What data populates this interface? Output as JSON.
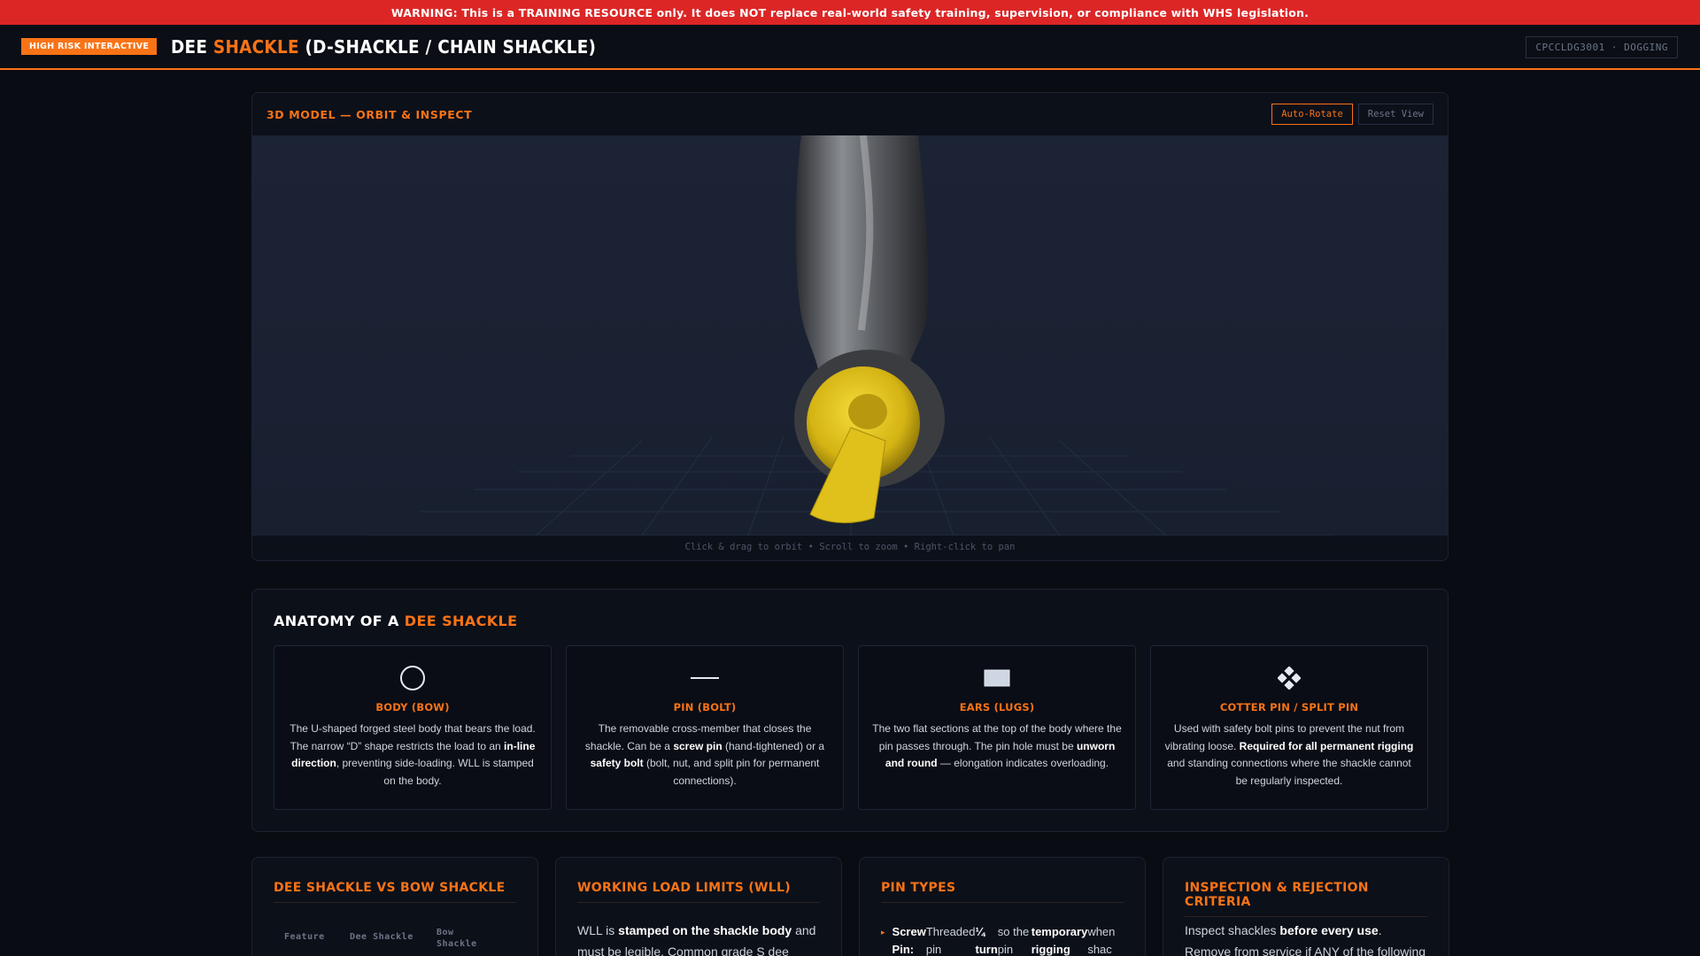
{
  "warning": "WARNING: This is a TRAINING RESOURCE only. It does NOT replace real-world safety training, supervision, or compliance with WHS legislation.",
  "header": {
    "badge": "High Risk Interactive",
    "title_pre": "DEE ",
    "title_accent": "SHACKLE",
    "title_post": " (D-SHACKLE / CHAIN SHACKLE)",
    "course": "CPCCLDG3001 · DOGGING"
  },
  "viewer": {
    "title": "3D Model — Orbit & Inspect",
    "auto_rotate": "Auto-Rotate",
    "reset_view": "Reset View",
    "hint": "Click & drag to orbit • Scroll to zoom • Right-click to pan",
    "colors": {
      "steel": "#5a5d62",
      "pin": "#e3c21a",
      "grid": "#2a3348"
    }
  },
  "anatomy": {
    "title_pre": "Anatomy of a ",
    "title_accent": "Dee Shackle",
    "cards": [
      {
        "icon": "circle-icon",
        "name": "Body (Bow)",
        "desc_parts": [
          "The U-shaped forged steel body that bears the load. The narrow “D” shape restricts the load to an ",
          "in-line direction",
          ", preventing side-loading. WLL is stamped on the body."
        ]
      },
      {
        "icon": "line-icon",
        "name": "Pin (Bolt)",
        "desc_parts": [
          "The removable cross-member that closes the shackle. Can be a ",
          "screw pin",
          " (hand-tightened) or a ",
          "safety bolt",
          " (bolt, nut, and split pin for permanent connections)."
        ]
      },
      {
        "icon": "square-icon",
        "name": "Ears (Lugs)",
        "desc_parts": [
          "The two flat sections at the top of the body where the pin passes through. The pin hole must be ",
          "unworn and round",
          " — elongation indicates overloading."
        ]
      },
      {
        "icon": "diamond-icon",
        "name": "Cotter Pin / Split Pin",
        "desc_parts": [
          "Used with safety bolt pins to prevent the nut from vibrating loose. ",
          "Required for all permanent rigging",
          " and standing connections where the shackle cannot be regularly inspected."
        ]
      }
    ]
  },
  "info": {
    "compare": {
      "title": "Dee Shackle vs Bow Shackle",
      "columns": [
        "Feature",
        "Dee Shackle",
        "Bow Shackle"
      ]
    },
    "wll": {
      "title": "Working Load Limits (WLL)",
      "text_pre": "WLL is ",
      "text_bold": "stamped on the shackle body",
      "text_post": " and must be legible. Common grade S dee"
    },
    "pins": {
      "title": "Pin Types",
      "row": [
        "Screw Pin:",
        "Threaded pin",
        "¼ turn",
        "so the pin can",
        "temporary rigging",
        "when shac"
      ]
    },
    "inspection": {
      "title": "Inspection & Rejection Criteria",
      "text_pre": "Inspect shackles ",
      "text_bold": "before every use",
      "text_post": ". Remove from service if ANY of the following are"
    }
  }
}
